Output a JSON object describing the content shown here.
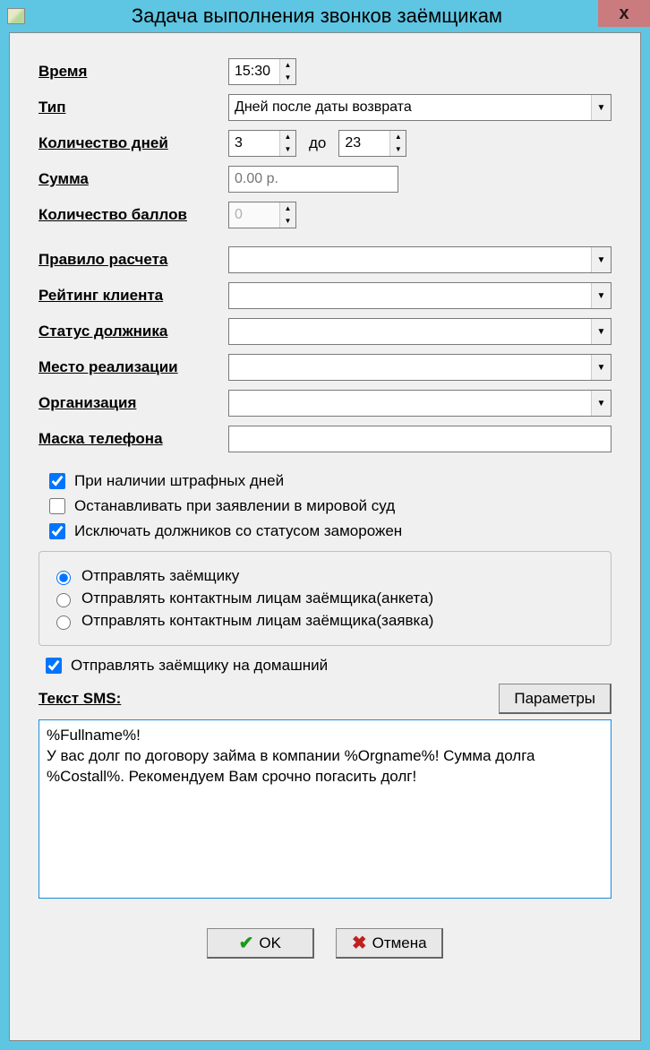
{
  "window": {
    "title": "Задача выполнения звонков заёмщикам",
    "close_label": "x"
  },
  "labels": {
    "time": "Время",
    "type": "Тип",
    "day_count": "Количество дней",
    "to": "до",
    "sum": "Сумма",
    "point_count": "Количество баллов",
    "calc_rule": "Правило расчета",
    "client_rating": "Рейтинг клиента",
    "debtor_status": "Статус должника",
    "realization_place": "Место реализации",
    "organization": "Организация",
    "phone_mask": "Маска телефона",
    "sms_text": "Текст SMS:"
  },
  "fields": {
    "time": "15:30",
    "type_selected": "Дней после даты возврата",
    "days_from": "3",
    "days_to": "23",
    "sum_placeholder": "0.00 р.",
    "points": "0",
    "calc_rule": "",
    "client_rating": "",
    "debtor_status": "",
    "realization_place": "",
    "organization": "",
    "phone_mask": ""
  },
  "checks": {
    "penalty_days": {
      "label": "При наличии штрафных дней",
      "checked": true
    },
    "stop_on_court": {
      "label": "Останавливать при заявлении в мировой суд",
      "checked": false
    },
    "exclude_frozen": {
      "label": "Исключать должников со статусом заморожен",
      "checked": true
    },
    "send_home": {
      "label": "Отправлять заёмщику на домашний",
      "checked": true
    }
  },
  "radios": {
    "send_borrower": "Отправлять заёмщику",
    "send_contacts_form": "Отправлять контактным лицам заёмщика(анкета)",
    "send_contacts_app": "Отправлять контактным лицам заёмщика(заявка)",
    "selected": "send_borrower"
  },
  "sms_text": "%Fullname%!\nУ вас долг по договору займа в компании %Orgname%! Сумма долга %Costall%. Рекомендуем Вам срочно погасить долг!",
  "buttons": {
    "params": "Параметры",
    "ok": "OK",
    "cancel": "Отмена"
  }
}
